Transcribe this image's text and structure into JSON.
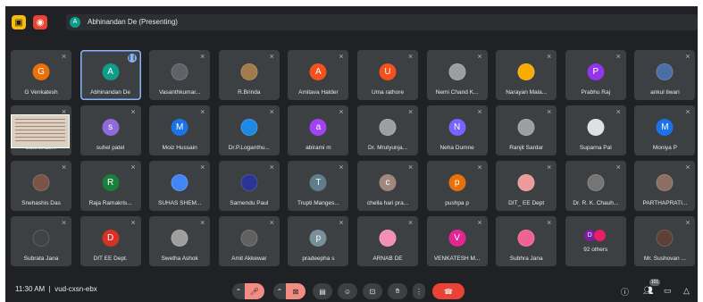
{
  "topbar": {
    "presenter_initial": "A",
    "presenter_text": "Abhinandan De (Presenting)"
  },
  "tiles": [
    {
      "name": "G Venkatesh",
      "initial": "G",
      "color": "#e8710a",
      "muted": true
    },
    {
      "name": "Abhinandan De",
      "initial": "A",
      "color": "#0f9d8b",
      "speaking": true,
      "active": true
    },
    {
      "name": "Vasanthkumar...",
      "photo": true,
      "color": "#5f6368",
      "muted": true
    },
    {
      "name": "R.Brinda",
      "photo": true,
      "color": "#a07b4c",
      "muted": true
    },
    {
      "name": "Amitava Halder",
      "initial": "A",
      "color": "#f4511e",
      "muted": true
    },
    {
      "name": "Uma rathore",
      "initial": "U",
      "color": "#f4511e",
      "muted": true
    },
    {
      "name": "Nemi Chand K...",
      "photo": true,
      "color": "#9e9e9e",
      "muted": true
    },
    {
      "name": "Narayan Mala...",
      "photo": true,
      "color": "#f9ab00",
      "muted": true
    },
    {
      "name": "Prabhu Raj",
      "initial": "P",
      "color": "#9334e6",
      "muted": true
    },
    {
      "name": "ankul tiwari",
      "photo": true,
      "color": "#4a6fa5",
      "muted": true
    },
    {
      "name": "Sukhendu...",
      "photo": true,
      "color": "#8d6e63",
      "muted": true
    },
    {
      "name": "suhel patel",
      "initial": "s",
      "color": "#8e6bd8",
      "muted": true
    },
    {
      "name": "Moiz Hussain",
      "initial": "M",
      "color": "#1a73e8",
      "muted": true
    },
    {
      "name": "Dr.P.Loganthu...",
      "photo": true,
      "color": "#1e88e5",
      "muted": true
    },
    {
      "name": "abirami m",
      "initial": "a",
      "color": "#a142f4",
      "muted": true
    },
    {
      "name": "Dr. Mrutyunja...",
      "photo": true,
      "color": "#9e9e9e",
      "muted": true
    },
    {
      "name": "Neha Dumne",
      "initial": "N",
      "color": "#7b61ff",
      "muted": true
    },
    {
      "name": "Ranjit Sardar",
      "photo": true,
      "color": "#9e9e9e",
      "muted": true
    },
    {
      "name": "Suparna Pal",
      "photo": true,
      "color": "#e0e0e0",
      "muted": true
    },
    {
      "name": "Moniya P",
      "initial": "M",
      "color": "#1a73e8",
      "muted": true
    },
    {
      "name": "Snehashis Das",
      "photo": true,
      "color": "#795548",
      "muted": true
    },
    {
      "name": "Raja Ramakris...",
      "initial": "R",
      "color": "#188038",
      "muted": true
    },
    {
      "name": "SUHAS SHEM...",
      "photo": true,
      "color": "#4285f4",
      "muted": true
    },
    {
      "name": "Sarnendu Paul",
      "photo": true,
      "color": "#283593",
      "muted": true
    },
    {
      "name": "Trupti Manges...",
      "initial": "T",
      "color": "#607d8b",
      "muted": true
    },
    {
      "name": "chella hari pra...",
      "initial": "c",
      "color": "#a1887f",
      "muted": true
    },
    {
      "name": "pushpa p",
      "initial": "p",
      "color": "#e8710a",
      "muted": true
    },
    {
      "name": "DIT_ EE Dept",
      "photo": true,
      "color": "#ef9a9a",
      "muted": true
    },
    {
      "name": "Dr. R. K. Chauh...",
      "photo": true,
      "color": "#757575",
      "muted": true
    },
    {
      "name": "PARTHAPRATI...",
      "photo": true,
      "color": "#8d6e63",
      "muted": true
    },
    {
      "name": "Subrata Jana",
      "photo": true,
      "color": "#424242",
      "muted": true
    },
    {
      "name": "DIT EE Dept.",
      "initial": "D",
      "color": "#d93025",
      "muted": true
    },
    {
      "name": "Swetha Ashok",
      "photo": true,
      "color": "#9e9e9e",
      "muted": true
    },
    {
      "name": "Amit Akkewar",
      "photo": true,
      "color": "#616161",
      "muted": true
    },
    {
      "name": "pradeepha s",
      "initial": "p",
      "color": "#78909c",
      "muted": true
    },
    {
      "name": "ARNAB DE",
      "photo": true,
      "color": "#f48fb1",
      "muted": true
    },
    {
      "name": "VENKATESH M...",
      "initial": "V",
      "color": "#e52592",
      "muted": true
    },
    {
      "name": "Subhra Jana",
      "photo": true,
      "color": "#f06292",
      "muted": true
    },
    {
      "name": "92 others",
      "others": true,
      "muted": false
    },
    {
      "name": "Mr. Sushovan ...",
      "photo": true,
      "color": "#5d4037",
      "muted": true
    }
  ],
  "others": {
    "a": "D",
    "a_color": "#7b1fa2",
    "b_color": "#e91e63"
  },
  "bottombar": {
    "time": "11:30 AM",
    "separator": "|",
    "meeting_code": "vud-cxsn-ebx",
    "participant_count": "101"
  }
}
